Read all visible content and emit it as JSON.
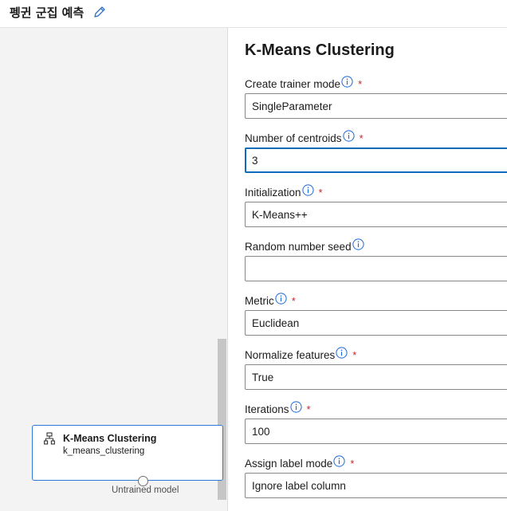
{
  "header": {
    "pipeline_title": "펭귄 군집 예측"
  },
  "canvas": {
    "module": {
      "name": "K-Means Clustering",
      "subtitle": "k_means_clustering",
      "output_port_label": "Untrained model"
    }
  },
  "panel": {
    "title": "K-Means Clustering",
    "required_marker": "*",
    "params": [
      {
        "label": "Create trainer mode",
        "value": "SingleParameter",
        "required": true,
        "type": "dropdown"
      },
      {
        "label": "Number of centroids",
        "value": "3",
        "required": true,
        "type": "input"
      },
      {
        "label": "Initialization",
        "value": "K-Means++",
        "required": true,
        "type": "dropdown"
      },
      {
        "label": "Random number seed",
        "value": "",
        "required": false,
        "type": "input"
      },
      {
        "label": "Metric",
        "value": "Euclidean",
        "required": true,
        "type": "dropdown"
      },
      {
        "label": "Normalize features",
        "value": "True",
        "required": true,
        "type": "dropdown"
      },
      {
        "label": "Iterations",
        "value": "100",
        "required": true,
        "type": "input"
      },
      {
        "label": "Assign label mode",
        "value": "Ignore label column",
        "required": true,
        "type": "dropdown"
      }
    ]
  },
  "colors": {
    "accent": "#0f6cbd",
    "node_border": "#2d7ad6",
    "required": "#c4262e",
    "canvas_bg": "#f3f3f3"
  }
}
